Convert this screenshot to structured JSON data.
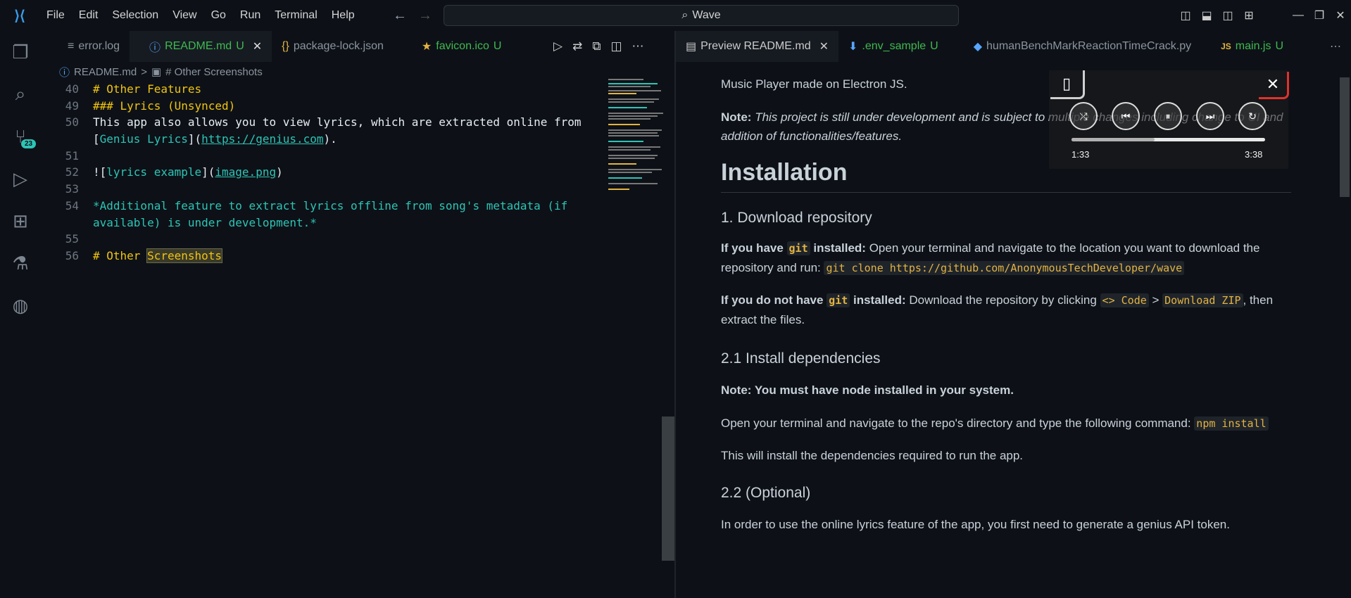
{
  "menu": [
    "File",
    "Edit",
    "Selection",
    "View",
    "Go",
    "Run",
    "Terminal",
    "Help"
  ],
  "search": {
    "label": "Wave"
  },
  "activity": {
    "badge": "23"
  },
  "left_tabs": [
    {
      "icon": "≡",
      "label": "error.log",
      "mod": ""
    },
    {
      "icon": "ⓘ",
      "label": "README.md",
      "mod": "U"
    },
    {
      "icon": "{}",
      "label": "package-lock.json",
      "mod": ""
    },
    {
      "icon": "★",
      "label": "favicon.ico",
      "mod": "U"
    }
  ],
  "breadcrumb": {
    "file": "README.md",
    "sep": ">",
    "section": "# Other Screenshots"
  },
  "code": {
    "l40": {
      "num": "40",
      "text": "# Other Features"
    },
    "l49": {
      "num": "49",
      "text": "### Lyrics (Unsynced)"
    },
    "l50a": {
      "num": "50",
      "text": "This app also allows you to view lyrics, which are extracted online from"
    },
    "l50b": {
      "p1": "[",
      "link": "Genius Lyrics",
      "p2": "](",
      "url": "https://genius.com",
      "p3": ")."
    },
    "l51": {
      "num": "51"
    },
    "l52": {
      "num": "52",
      "p1": "![",
      "alt": "lyrics example",
      "p2": "](",
      "src": "image.png",
      "p3": ")"
    },
    "l53": {
      "num": "53"
    },
    "l54a": {
      "num": "54",
      "text": "*Additional feature to extract lyrics offline from song's metadata (if"
    },
    "l54b": {
      "text": "available) is under development.*"
    },
    "l55": {
      "num": "55"
    },
    "l56": {
      "num": "56",
      "p1": "# Other ",
      "hl": "Screenshots"
    }
  },
  "right_tabs": [
    {
      "icon": "▤",
      "label": "Preview README.md",
      "mod": ""
    },
    {
      "icon": "⬇",
      "label": ".env_sample",
      "mod": "U"
    },
    {
      "icon": "◆",
      "label": "humanBenchMarkReactionTimeCrack.py",
      "mod": ""
    },
    {
      "icon": "JS",
      "label": "main.js",
      "mod": "U"
    }
  ],
  "preview": {
    "intro": "Music Player made on Electron JS.",
    "note_label": "Note:",
    "note_text": "This project is still under development and is subject to multiple changes including change to UI and addition of functionalities/features.",
    "h_install": "Installation",
    "h_download": "1. Download repository",
    "git_yes_a": "If you have ",
    "git_code": "git",
    "git_yes_b": " installed:",
    "git_yes_c": " Open your terminal and navigate to the location you want to download the repository and run: ",
    "git_clone": "git clone https://github.com/AnonymousTechDeveloper/wave",
    "git_no_a": "If you do not have ",
    "git_no_b": " installed:",
    "git_no_c": " Download the repository by clicking ",
    "code_btn": "<> Code",
    "gt": " > ",
    "zip_btn": "Download ZIP",
    "git_no_d": ", then extract the files.",
    "h_deps": "2.1 Install dependencies",
    "node_note": "Note: You must have node installed in your system.",
    "open_term": "Open your terminal and navigate to the repo's directory and type the following command: ",
    "npm": "npm install",
    "will_install": "This will install the dependencies required to run the app.",
    "h_optional": "2.2 (Optional)",
    "genius": "In order to use the online lyrics feature of the app, you first need to generate a genius API token."
  },
  "player": {
    "elapsed": "1:33",
    "total": "3:38",
    "progress": 0.43
  }
}
